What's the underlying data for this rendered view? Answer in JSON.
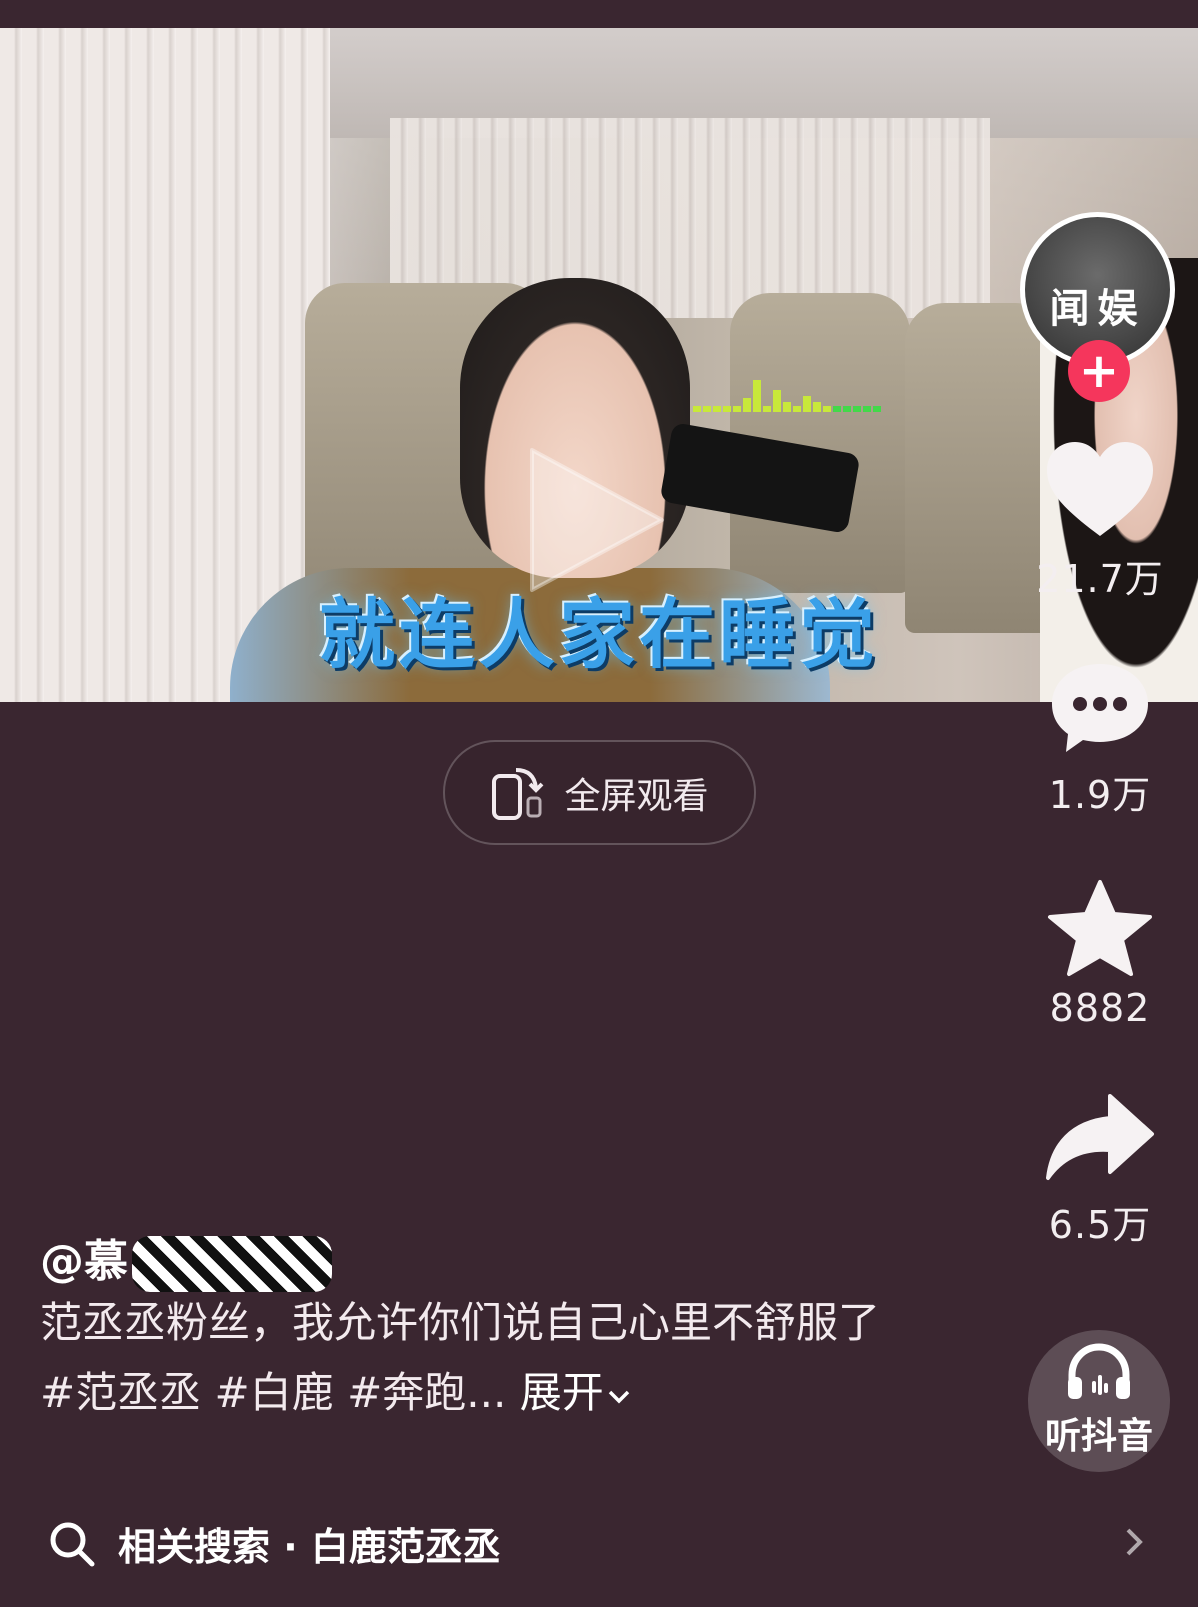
{
  "video": {
    "subtitle": "就连人家在睡觉"
  },
  "fullscreen": {
    "label": "全屏观看"
  },
  "creator": {
    "avatar_text": "闻娱",
    "follow_symbol": "+"
  },
  "actions": {
    "likes": "21.7万",
    "comments": "1.9万",
    "favorites": "8882",
    "shares": "6.5万",
    "listen_label": "听抖音"
  },
  "post": {
    "author": "@慕",
    "description": "范丞丞粉丝，我允许你们说自己心里不舒服了 #范丞丞 #白鹿 #奔跑...",
    "expand_label": "展开"
  },
  "related_search": {
    "label": "相关搜索 · 白鹿范丞丞"
  },
  "colors": {
    "background": "#3a2630",
    "follow_button": "#f5365c",
    "subtitle": "#3aa0e8"
  },
  "icons": {
    "like": "heart-icon",
    "comment": "comment-bubble-icon",
    "favorite": "star-icon",
    "share": "share-arrow-icon",
    "listen": "headphones-icon",
    "search": "search-icon",
    "fullscreen": "rotate-phone-icon"
  }
}
